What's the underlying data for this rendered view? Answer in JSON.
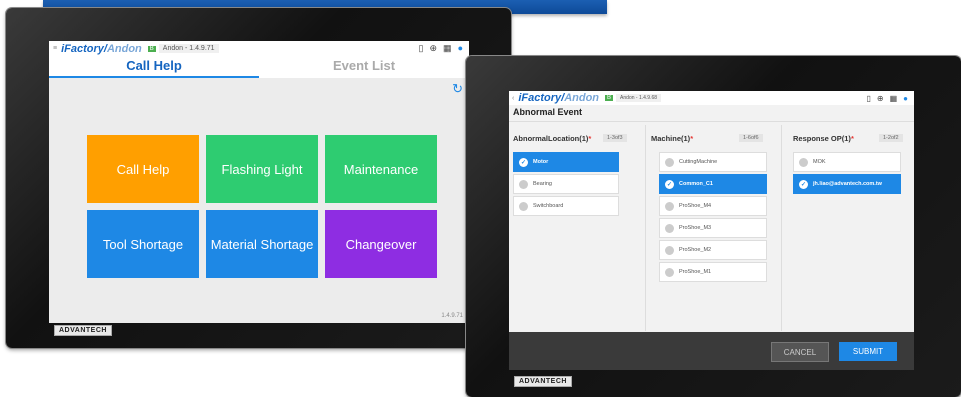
{
  "left_app": {
    "logo_main": "iFactory/",
    "logo_sub": "Andon",
    "badge": "B",
    "version_label": "Andon - 1.4.9.71",
    "tabs": [
      "Call Help",
      "Event List"
    ],
    "tiles": [
      {
        "label": "Call Help",
        "color": "#ff9f00"
      },
      {
        "label": "Flashing Light",
        "color": "#2ecc71"
      },
      {
        "label": "Maintenance",
        "color": "#2ecc71"
      },
      {
        "label": "Tool Shortage",
        "color": "#1e88e5"
      },
      {
        "label": "Material Shortage",
        "color": "#1e88e5"
      },
      {
        "label": "Changeover",
        "color": "#8e2de2"
      }
    ],
    "footer_version": "1.4.9.71",
    "brand": "ADVANTECH"
  },
  "right_app": {
    "logo_main": "iFactory/",
    "logo_sub": "Andon",
    "badge": "B",
    "version_label": "Andon - 1.4.9.68",
    "title": "Abnormal Event",
    "columns": [
      {
        "title": "AbnormalLocation(1)",
        "pager": "1-3of3",
        "items": [
          {
            "label": "Motor",
            "selected": true
          },
          {
            "label": "Bearing",
            "selected": false
          },
          {
            "label": "Switchboard",
            "selected": false
          }
        ]
      },
      {
        "title": "Machine(1)",
        "pager": "1-6of6",
        "items": [
          {
            "label": "CuttingMachine",
            "selected": false
          },
          {
            "label": "Common_C1",
            "selected": true
          },
          {
            "label": "ProShoe_M4",
            "selected": false
          },
          {
            "label": "ProShoe_M3",
            "selected": false
          },
          {
            "label": "ProShoe_M2",
            "selected": false
          },
          {
            "label": "ProShoe_M1",
            "selected": false
          }
        ]
      },
      {
        "title": "Response OP(1)",
        "pager": "1-2of2",
        "items": [
          {
            "label": "MOK",
            "selected": false
          },
          {
            "label": "jh.liao@advantech.com.tw",
            "selected": true
          }
        ]
      }
    ],
    "cancel_label": "CANCEL",
    "submit_label": "SUBMIT",
    "brand": "ADVANTECH"
  },
  "colors": {
    "accent": "#1e88e5",
    "orange": "#ff9f00",
    "green": "#2ecc71",
    "purple": "#8e2de2"
  }
}
